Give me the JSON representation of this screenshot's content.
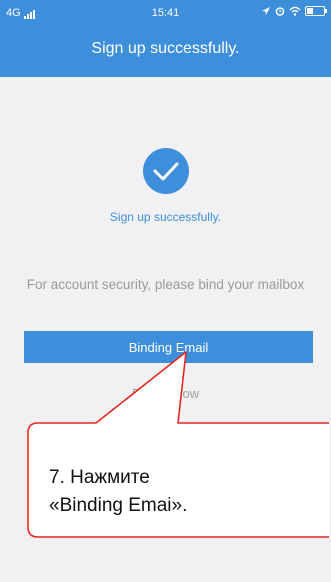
{
  "status_bar": {
    "network": "4G",
    "time": "15:41"
  },
  "header": {
    "title": "Sign up successfully."
  },
  "main": {
    "check_icon": "checkmark-icon",
    "success_text": "Sign up successfully.",
    "security_text": "For account security, please bind your mailbox",
    "bind_button_label": "Binding Email",
    "skip_label": "Bind in now"
  },
  "callout": {
    "line1": "7. Нажмите",
    "line2": "«Binding Emai».",
    "border_color": "#e8281f"
  },
  "colors": {
    "accent": "#3d8fdb",
    "background": "#f1f1f3"
  }
}
